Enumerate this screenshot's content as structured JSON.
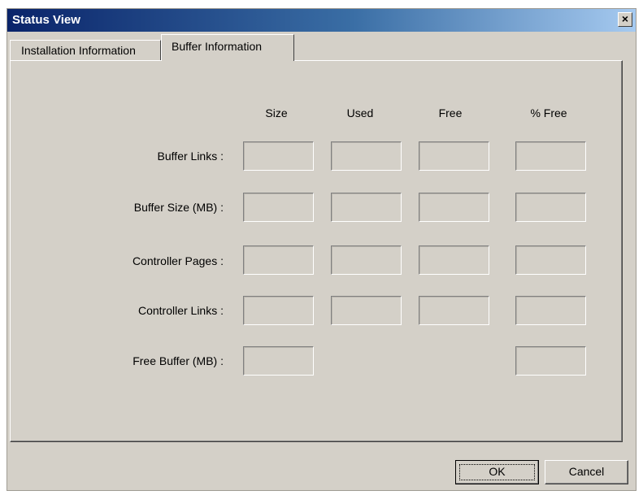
{
  "window": {
    "title": "Status View",
    "close_label": "×"
  },
  "tabs": [
    {
      "label": "Installation Information",
      "active": false
    },
    {
      "label": "Buffer Information",
      "active": true
    }
  ],
  "columns": [
    "Size",
    "Used",
    "Free",
    "% Free"
  ],
  "rows": [
    {
      "label": "Buffer Links :",
      "fields": [
        "",
        "",
        "",
        ""
      ]
    },
    {
      "label": "Buffer Size (MB) :",
      "fields": [
        "",
        "",
        "",
        ""
      ]
    },
    {
      "label": "Controller Pages :",
      "fields": [
        "",
        "",
        "",
        ""
      ]
    },
    {
      "label": "Controller Links :",
      "fields": [
        "",
        "",
        "",
        ""
      ]
    },
    {
      "label": "Free Buffer (MB) :",
      "fields": [
        "",
        null,
        null,
        ""
      ]
    }
  ],
  "buttons": {
    "ok_label": "OK",
    "cancel_label": "Cancel"
  }
}
